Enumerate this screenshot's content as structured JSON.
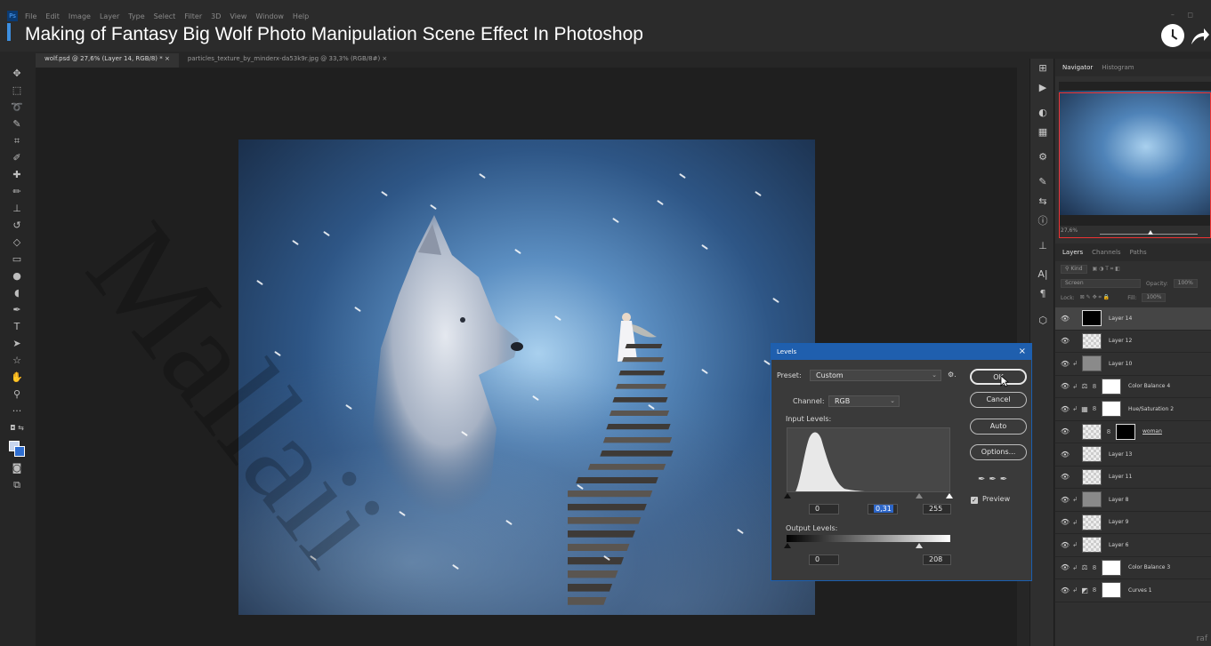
{
  "video": {
    "title": "Making of Fantasy Big Wolf Photo Manipulation Scene Effect In Photoshop"
  },
  "menu": [
    "File",
    "Edit",
    "Image",
    "Layer",
    "Type",
    "Select",
    "Filter",
    "3D",
    "View",
    "Window",
    "Help"
  ],
  "doc_tabs": [
    {
      "label": "wolf.psd @ 27,6% (Layer 14, RGB/8) *",
      "active": true
    },
    {
      "label": "particles_texture_by_minderx-da53k9r.jpg @ 33,3% (RGB/8#)",
      "active": false
    }
  ],
  "navigator": {
    "tabs": [
      "Navigator",
      "Histogram"
    ],
    "zoom": "27,6%"
  },
  "layers_panel": {
    "tabs": [
      "Layers",
      "Channels",
      "Paths"
    ],
    "kind_label": "Kind",
    "blend_mode": "Screen",
    "opacity_label": "Opacity:",
    "opacity": "100%",
    "lock_label": "Lock:",
    "fill_label": "Fill:",
    "fill": "100%",
    "layers": [
      {
        "name": "Layer 14",
        "thumb": "black",
        "clip": false,
        "adj": "",
        "mask": false,
        "selected": true
      },
      {
        "name": "Layer 12",
        "thumb": "checker",
        "clip": false,
        "adj": "",
        "mask": false,
        "selected": false
      },
      {
        "name": "Layer 10",
        "thumb": "gray",
        "clip": true,
        "adj": "",
        "mask": false,
        "selected": false
      },
      {
        "name": "Color Balance 4",
        "thumb": "white",
        "clip": true,
        "adj": "⚖",
        "mask": true,
        "selected": false
      },
      {
        "name": "Hue/Saturation 2",
        "thumb": "white",
        "clip": true,
        "adj": "▦",
        "mask": true,
        "selected": false
      },
      {
        "name": "woman",
        "thumb": "black",
        "clip": false,
        "adj": "",
        "mask": true,
        "selected": false,
        "underline": true
      },
      {
        "name": "Layer 13",
        "thumb": "checker",
        "clip": false,
        "adj": "",
        "mask": false,
        "selected": false
      },
      {
        "name": "Layer 11",
        "thumb": "checker",
        "clip": false,
        "adj": "",
        "mask": false,
        "selected": false
      },
      {
        "name": "Layer 8",
        "thumb": "gray",
        "clip": true,
        "adj": "",
        "mask": false,
        "selected": false
      },
      {
        "name": "Layer 9",
        "thumb": "checker",
        "clip": true,
        "adj": "",
        "mask": false,
        "selected": false
      },
      {
        "name": "Layer 6",
        "thumb": "checker",
        "clip": true,
        "adj": "",
        "mask": false,
        "selected": false
      },
      {
        "name": "Color Balance 3",
        "thumb": "white",
        "clip": true,
        "adj": "⚖",
        "mask": true,
        "selected": false
      },
      {
        "name": "Curves 1",
        "thumb": "white",
        "clip": true,
        "adj": "◩",
        "mask": true,
        "selected": false
      }
    ]
  },
  "levels": {
    "title": "Levels",
    "preset_label": "Preset:",
    "preset_value": "Custom",
    "channel_label": "Channel:",
    "channel_value": "RGB",
    "input_label": "Input Levels:",
    "input_black": "0",
    "input_gamma": "0,31",
    "input_white": "255",
    "output_label": "Output Levels:",
    "output_black": "0",
    "output_white": "208",
    "buttons": {
      "ok": "OK",
      "cancel": "Cancel",
      "auto": "Auto",
      "options": "Options..."
    },
    "preview_label": "Preview",
    "preview_checked": true
  },
  "watermark": "Mallaii",
  "corner_tag": "raf",
  "colors": {
    "accent": "#1f5fae",
    "selection_frame": "#e33333"
  }
}
